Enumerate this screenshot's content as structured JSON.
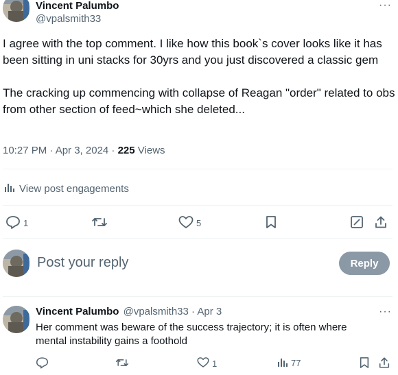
{
  "post": {
    "author_name": "Vincent Palumbo",
    "author_handle": "@vpalsmith33",
    "text": "I agree with the top comment. I like how this book`s cover looks like it has been sitting in uni stacks for 30yrs and you just discovered a classic gem\n\nThe cracking up commencing with collapse of Reagan \"order\" related to obs from other section of feed~which she deleted...",
    "timestamp": "10:27 PM · Apr 3, 2024 · ",
    "views_count": "225",
    "views_label": " Views",
    "engagements_label": "View post engagements",
    "actions": {
      "reply_count": "1",
      "like_count": "5"
    }
  },
  "composer": {
    "placeholder": "Post your reply",
    "reply_button": "Reply"
  },
  "reply": {
    "author_name": "Vincent Palumbo",
    "author_handle": "@vpalsmith33",
    "date": " · Apr 3",
    "text": "Her comment was beware of the success trajectory; it is often where\nmental instability gains a foothold",
    "actions": {
      "like_count": "1",
      "views_count": "77"
    }
  },
  "icons": {
    "more": "more-icon",
    "reply": "reply-icon",
    "repost": "repost-icon",
    "like": "heart-icon",
    "bookmark": "bookmark-icon",
    "edit": "edit-icon",
    "share": "share-icon",
    "analytics": "analytics-icon"
  },
  "colors": {
    "text": "#0f1419",
    "muted": "#536471",
    "divider": "#eff3f4",
    "reply_button_disabled": "#8b98a5"
  }
}
